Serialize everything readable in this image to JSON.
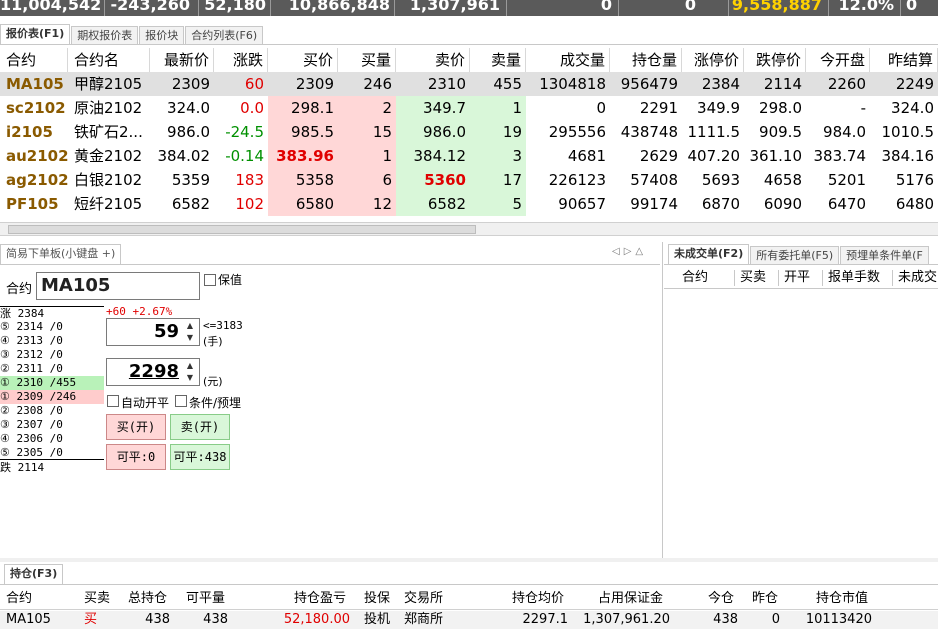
{
  "top_summary": {
    "values": [
      "11,004,542",
      "-243,260",
      "52,180",
      "10,866,848",
      "1,307,961",
      "0",
      "9,558,887",
      "12.0%",
      "0"
    ]
  },
  "main_tabs": [
    {
      "label": "报价表(F1)",
      "active": true
    },
    {
      "label": "期权报价表",
      "active": false
    },
    {
      "label": "报价块",
      "active": false
    },
    {
      "label": "合约列表(F6)",
      "active": false
    }
  ],
  "quote_table": {
    "headers": [
      "合约",
      "合约名",
      "最新价",
      "涨跌",
      "买价",
      "买量",
      "卖价",
      "卖量",
      "成交量",
      "持仓量",
      "涨停价",
      "跌停价",
      "今开盘",
      "昨结算"
    ],
    "rows": [
      [
        "MA105",
        "甲醇2105",
        "2309",
        "60",
        "2309",
        "246",
        "2310",
        "455",
        "1304818",
        "956479",
        "2384",
        "2114",
        "2260",
        "2249"
      ],
      [
        "sc2102",
        "原油2102",
        "324.0",
        "0.0",
        "298.1",
        "2",
        "349.7",
        "1",
        "0",
        "2291",
        "349.9",
        "298.0",
        "-",
        "324.0"
      ],
      [
        "i2105",
        "铁矿石2...",
        "986.0",
        "-24.5",
        "985.5",
        "15",
        "986.0",
        "19",
        "295556",
        "438748",
        "1111.5",
        "909.5",
        "984.0",
        "1010.5"
      ],
      [
        "au2102",
        "黄金2102",
        "384.02",
        "-0.14",
        "383.96",
        "1",
        "384.12",
        "3",
        "4681",
        "2629",
        "407.20",
        "361.10",
        "383.74",
        "384.16"
      ],
      [
        "ag2102",
        "白银2102",
        "5359",
        "183",
        "5358",
        "6",
        "5360",
        "17",
        "226123",
        "57408",
        "5693",
        "4658",
        "5201",
        "5176"
      ],
      [
        "PF105",
        "短纤2105",
        "6582",
        "102",
        "6580",
        "12",
        "6582",
        "5",
        "90657",
        "99174",
        "6870",
        "6090",
        "6470",
        "6480"
      ]
    ]
  },
  "order_panel": {
    "tab_label": "简易下单板(小键盘 +)",
    "contract_label": "合约",
    "contract_value": "MA105",
    "hedge_label": "保值",
    "limit_up": "涨 2384",
    "limit_down": "跌 2114",
    "change_text": "+60 +2.67%",
    "ask_levels": [
      "⑤ 2314 /0",
      "④ 2313 /0",
      "③ 2312 /0",
      "② 2311 /0",
      "① 2310 /455"
    ],
    "bid_levels": [
      "① 2309 /246",
      "② 2308 /0",
      "③ 2307 /0",
      "④ 2306 /0",
      "⑤ 2305 /0"
    ],
    "qty_value": "59",
    "qty_hint": "<=3183",
    "qty_unit": "(手)",
    "price_value": "2298",
    "price_unit": "(元)",
    "auto_open_close_label": "自动开平",
    "condition_label": "条件/预埋",
    "buy_open_label": "买(开)",
    "sell_open_label": "卖(开)",
    "closable_buy_label": "可平:0",
    "closable_sell_label": "可平:438"
  },
  "pending_panel": {
    "tabs": [
      "未成交单(F2)",
      "所有委托单(F5)",
      "预埋单条件单(F"
    ],
    "headers": [
      "合约",
      "买卖",
      "开平",
      "报单手数",
      "未成交"
    ]
  },
  "position_panel": {
    "tab_label": "持仓(F3)",
    "headers": [
      "合约",
      "买卖",
      "总持仓",
      "可平量",
      "持仓盈亏",
      "投保",
      "交易所",
      "持仓均价",
      "占用保证金",
      "今仓",
      "昨仓",
      "持仓市值"
    ],
    "rows": [
      [
        "MA105",
        "买",
        "438",
        "438",
        "52,180.00",
        "投机",
        "郑商所",
        "2297.1",
        "1,307,961.20",
        "438",
        "0",
        "10113420"
      ]
    ]
  },
  "colors": {
    "up": "#e00000",
    "down": "#009000",
    "bid_bg": "#ffd7d7",
    "ask_bg": "#d9f7d9",
    "code": "#8a5a00"
  }
}
